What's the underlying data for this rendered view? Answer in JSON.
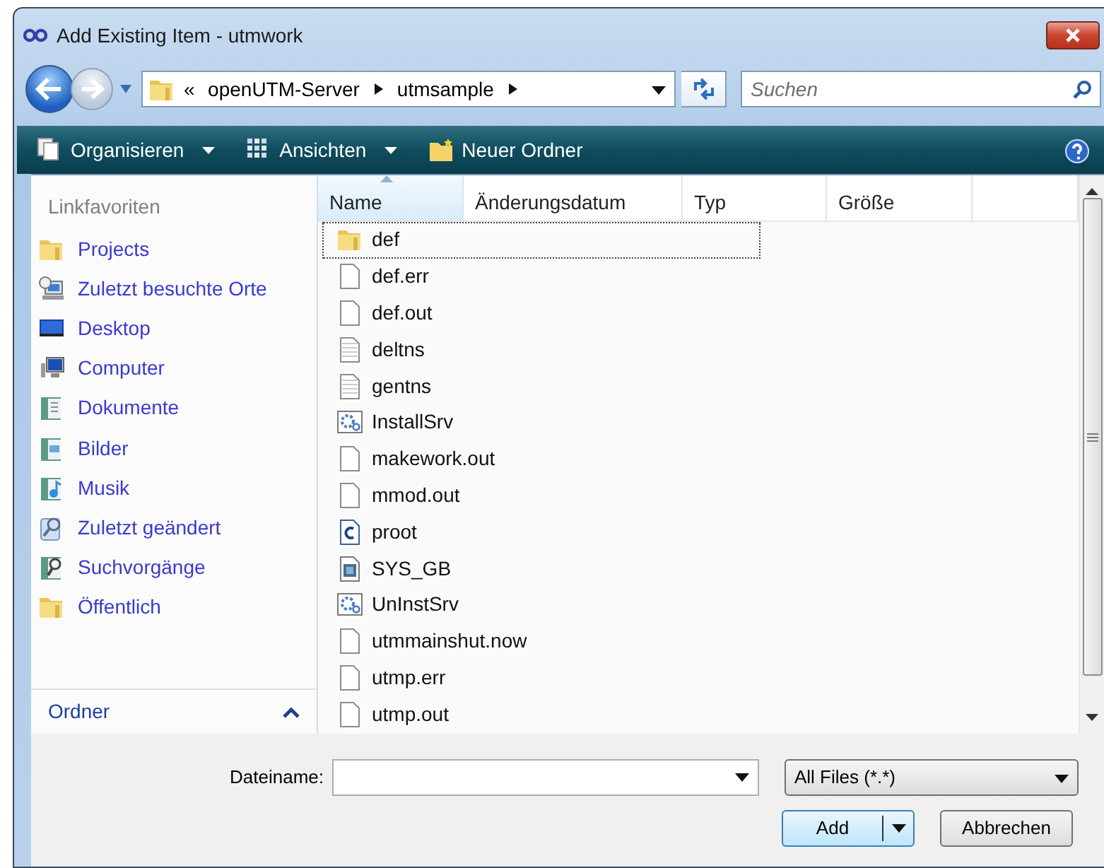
{
  "window": {
    "title": "Add Existing Item - utmwork"
  },
  "address": {
    "overflow": "«",
    "crumbs": [
      "openUTM-Server",
      "utmsample"
    ]
  },
  "search": {
    "placeholder": "Suchen"
  },
  "toolbar": [
    {
      "label": "Organisieren",
      "menu": true
    },
    {
      "label": "Ansichten",
      "menu": true
    },
    {
      "label": "Neuer Ordner",
      "menu": false
    }
  ],
  "sidebar": {
    "heading": "Linkfavoriten",
    "items": [
      {
        "label": "Projects",
        "kind": "folder"
      },
      {
        "label": "Zuletzt besuchte Orte",
        "kind": "recent"
      },
      {
        "label": "Desktop",
        "kind": "desktop"
      },
      {
        "label": "Computer",
        "kind": "computer"
      },
      {
        "label": "Dokumente",
        "kind": "documents"
      },
      {
        "label": "Bilder",
        "kind": "pictures"
      },
      {
        "label": "Musik",
        "kind": "music"
      },
      {
        "label": "Zuletzt geändert",
        "kind": "changed"
      },
      {
        "label": "Suchvorgänge",
        "kind": "searches"
      },
      {
        "label": "Öffentlich",
        "kind": "folder"
      }
    ],
    "footer": {
      "label": "Ordner",
      "expanded": true
    }
  },
  "table": {
    "columns": [
      {
        "label": "Name",
        "sorted": true
      },
      {
        "label": "Änderungsdatum",
        "sorted": false
      },
      {
        "label": "Typ",
        "sorted": false
      },
      {
        "label": "Größe",
        "sorted": false
      }
    ],
    "rows": [
      {
        "name": "def",
        "kind": "folder",
        "focused": true
      },
      {
        "name": "def.err",
        "kind": "file",
        "focused": false
      },
      {
        "name": "def.out",
        "kind": "file",
        "focused": false
      },
      {
        "name": "deltns",
        "kind": "text",
        "focused": false
      },
      {
        "name": "gentns",
        "kind": "text",
        "focused": false
      },
      {
        "name": "InstallSrv",
        "kind": "gear",
        "focused": false
      },
      {
        "name": "makework.out",
        "kind": "file",
        "focused": false
      },
      {
        "name": "mmod.out",
        "kind": "file",
        "focused": false
      },
      {
        "name": "proot",
        "kind": "c",
        "focused": false
      },
      {
        "name": "SYS_GB",
        "kind": "app",
        "focused": false
      },
      {
        "name": "UnInstSrv",
        "kind": "gear",
        "focused": false
      },
      {
        "name": "utmmainshut.now",
        "kind": "file",
        "focused": false
      },
      {
        "name": "utmp.err",
        "kind": "file",
        "focused": false
      },
      {
        "name": "utmp.out",
        "kind": "file",
        "focused": false
      }
    ]
  },
  "filename": {
    "label": "Dateiname:"
  },
  "filter": {
    "value": "All Files (*.*)"
  },
  "buttons": [
    {
      "label": "Add",
      "kind": "split"
    },
    {
      "label": "Abbrechen",
      "kind": "plain"
    }
  ]
}
